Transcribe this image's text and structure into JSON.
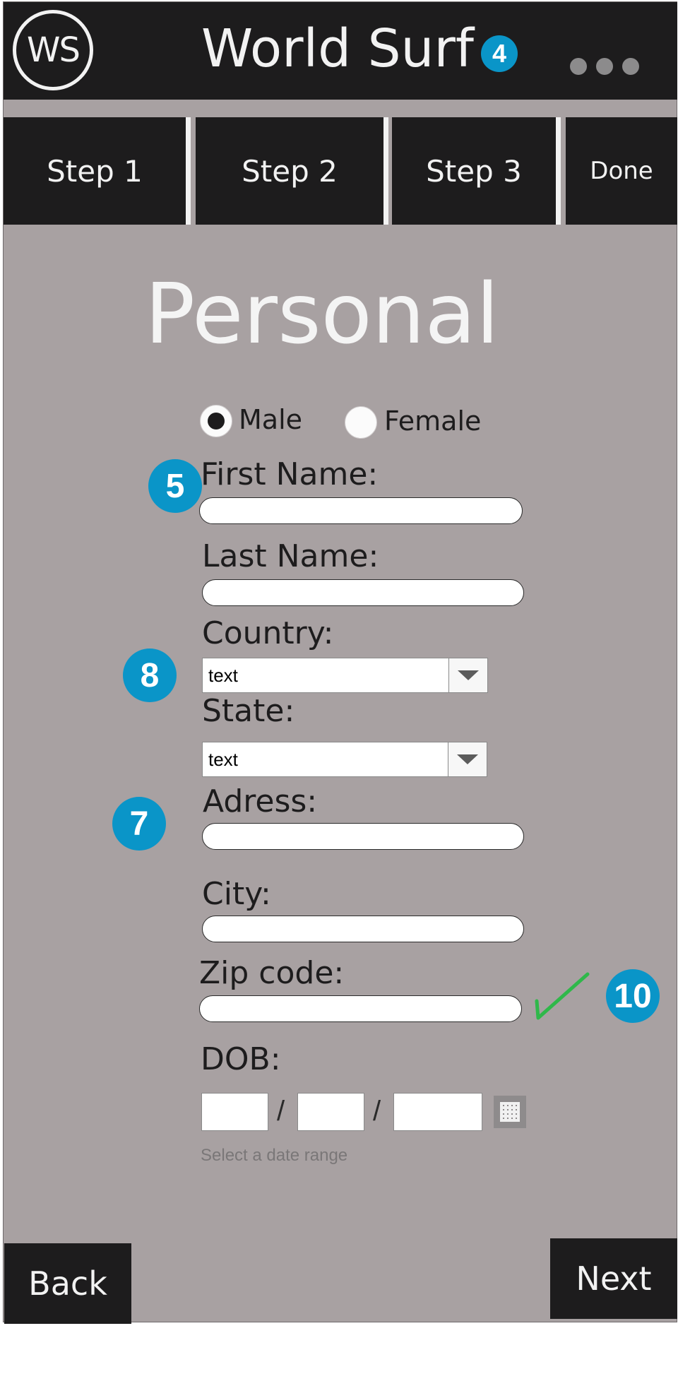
{
  "header": {
    "logo_text": "WS",
    "title": "World Surf",
    "badge": "4"
  },
  "steps": [
    "Step 1",
    "Step 2",
    "Step 3",
    "Done"
  ],
  "form": {
    "heading": "Personal",
    "gender": {
      "options": [
        "Male",
        "Female"
      ],
      "selected": "Male"
    },
    "first_name_label": "First Name:",
    "last_name_label": "Last Name:",
    "country_label": "Country:",
    "country_value": "text",
    "state_label": "State:",
    "state_value": "text",
    "address_label": "Adress:",
    "city_label": "City:",
    "zip_label": "Zip code:",
    "dob_label": "DOB:",
    "dob_separator": "/",
    "date_hint": "Select a date range"
  },
  "annotations": {
    "first_name": "5",
    "country": "8",
    "address": "7",
    "zip": "10"
  },
  "nav": {
    "back_label": "Back",
    "next_label": "Next"
  },
  "colors": {
    "dark": "#1d1c1d",
    "background": "#a8a1a2",
    "badge": "#0a95c8",
    "check": "#2fb84a"
  }
}
